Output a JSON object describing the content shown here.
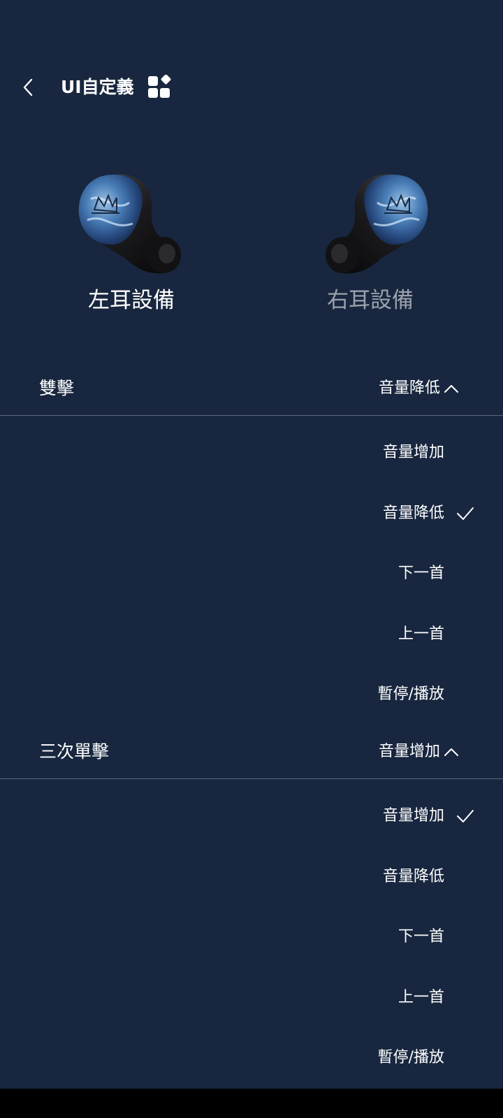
{
  "header": {
    "title": "UI自定義"
  },
  "earbuds": {
    "left_label": "左耳設備",
    "right_label": "右耳設備"
  },
  "sections": [
    {
      "name": "雙擊",
      "value": "音量降低",
      "options": [
        "音量增加",
        "音量降低",
        "下一首",
        "上一首",
        "暫停/播放"
      ],
      "selected_index": 1
    },
    {
      "name": "三次單擊",
      "value": "音量增加",
      "options": [
        "音量增加",
        "音量降低",
        "下一首",
        "上一首",
        "暫停/播放"
      ],
      "selected_index": 0
    }
  ],
  "colors": {
    "background": "#18273f",
    "text": "#ffffff",
    "inactive_text": "#9aa1ac",
    "divider": "#5f6b7c"
  }
}
